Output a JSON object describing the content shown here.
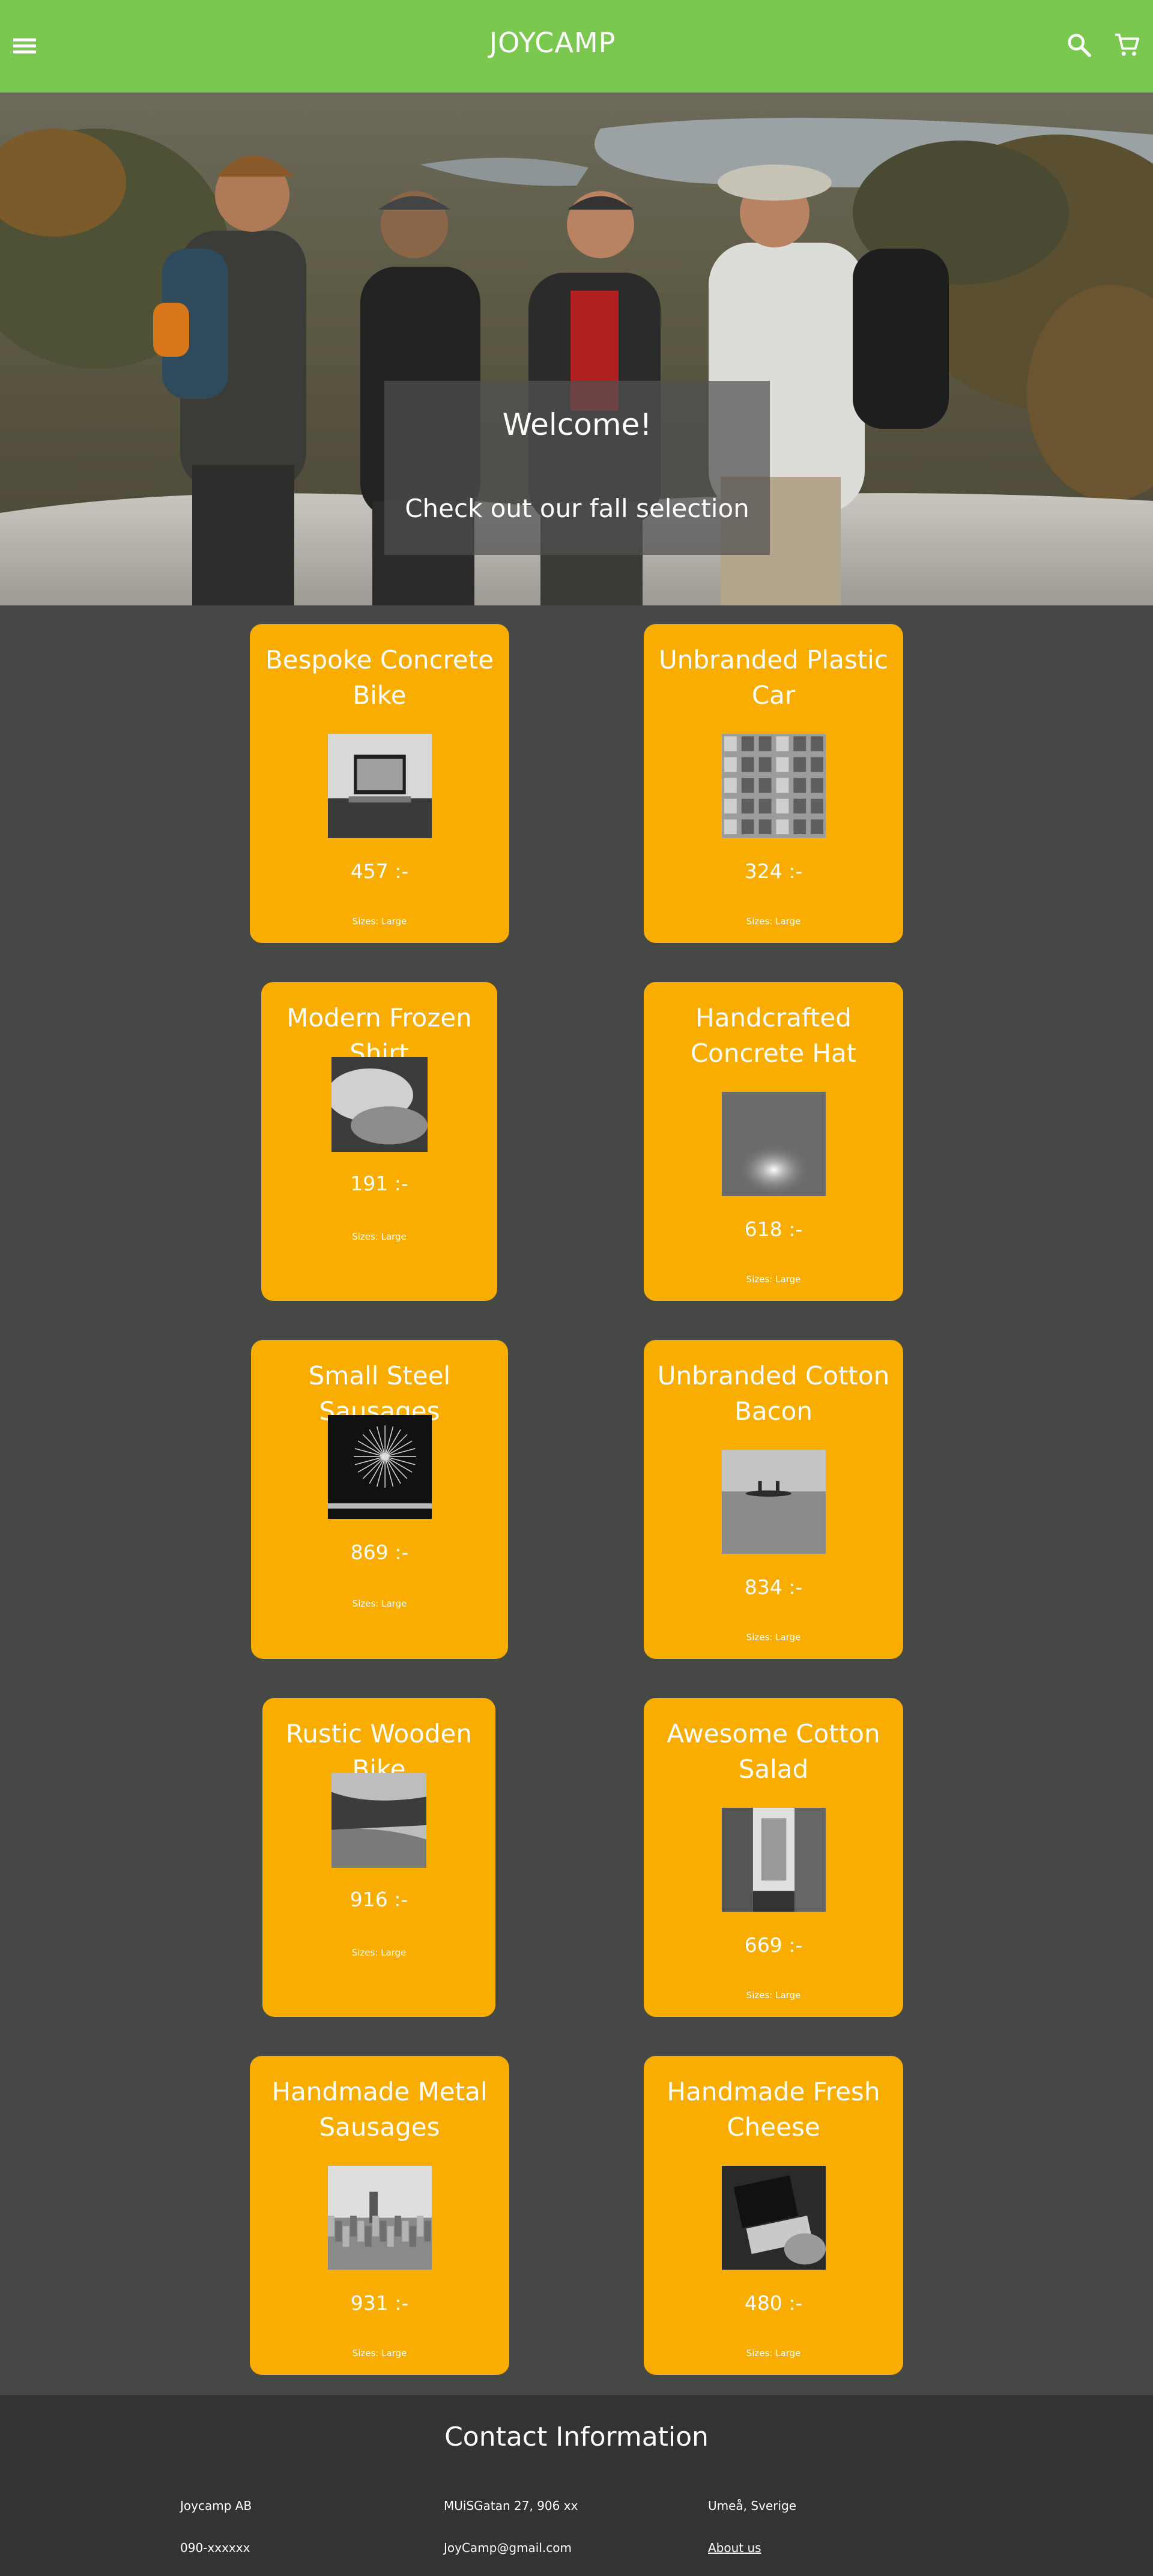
{
  "header": {
    "brand": "JOYCAMP",
    "bg_color": "#7ac84f",
    "icons": [
      "hamburger-menu-icon",
      "search-icon",
      "cart-icon"
    ]
  },
  "hero": {
    "title": "Welcome!",
    "subtitle": "Check out our fall selection"
  },
  "products": [
    {
      "title": "Bespoke Concrete Bike",
      "price": "457 :-",
      "sizes": "Sizes: Large",
      "image": "laptop-on-desk"
    },
    {
      "title": "Unbranded Plastic Car",
      "price": "324 :-",
      "sizes": "Sizes: Large",
      "image": "building-facade"
    },
    {
      "title": "Modern Frozen Shirt",
      "price": "191 :-",
      "sizes": "Sizes: Large",
      "image": "hands-closeup"
    },
    {
      "title": "Handcrafted Concrete Hat",
      "price": "618 :-",
      "sizes": "Sizes: Large",
      "image": "light-flare"
    },
    {
      "title": "Small Steel Sausages",
      "price": "869 :-",
      "sizes": "Sizes: Large",
      "image": "fireworks"
    },
    {
      "title": "Unbranded Cotton Bacon",
      "price": "834 :-",
      "sizes": "Sizes: Large",
      "image": "canoe-on-lake"
    },
    {
      "title": "Rustic Wooden Bike",
      "price": "916 :-",
      "sizes": "Sizes: Large",
      "image": "beach-coast"
    },
    {
      "title": "Awesome Cotton Salad",
      "price": "669 :-",
      "sizes": "Sizes: Large",
      "image": "city-street"
    },
    {
      "title": "Handmade Metal Sausages",
      "price": "931 :-",
      "sizes": "Sizes: Large",
      "image": "city-skyline"
    },
    {
      "title": "Handmade Fresh Cheese",
      "price": "480 :-",
      "sizes": "Sizes: Large",
      "image": "laptop-typing"
    }
  ],
  "footer": {
    "title": "Contact Information",
    "company": "Joycamp AB",
    "address": "MUiSGatan 27, 906 xx",
    "city": "Umeå, Sverige",
    "phone": "090-xxxxxx",
    "email": "JoyCamp@gmail.com",
    "about_link": "About us"
  },
  "colors": {
    "accent": "#f8ad00",
    "header": "#7ac84f",
    "background": "#464845",
    "footer": "#333333"
  }
}
